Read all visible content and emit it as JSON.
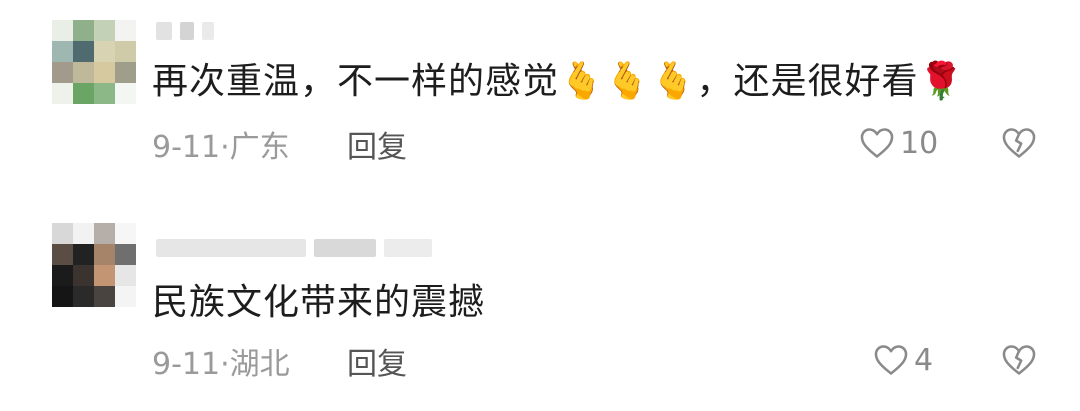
{
  "comments": [
    {
      "text": "再次重温，不一样的感觉🫰🫰🫰，还是很好看🌹",
      "date": "9-11",
      "location": "广东",
      "reply_label": "回复",
      "likes": "10"
    },
    {
      "text": "民族文化带来的震撼",
      "date": "9-11",
      "location": "湖北",
      "reply_label": "回复",
      "likes": "4"
    }
  ],
  "icons": {
    "like": "heart-outline-icon",
    "dislike": "broken-heart-icon"
  },
  "colors": {
    "text": "#1d1d1d",
    "meta": "#9a9a9a",
    "icon": "#8a8a8a"
  }
}
